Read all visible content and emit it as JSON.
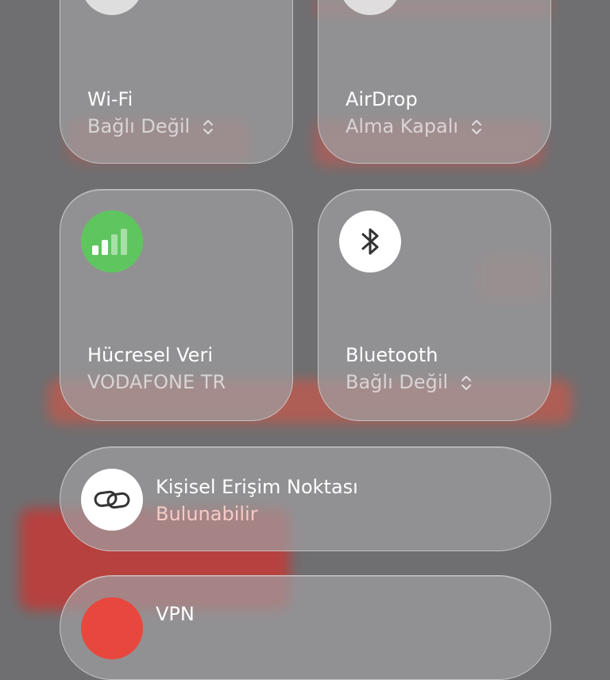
{
  "tiles": {
    "wifi": {
      "title": "Wi-Fi",
      "subtitle": "Bağlı Değil"
    },
    "airdrop": {
      "title": "AirDrop",
      "subtitle": "Alma Kapalı"
    },
    "cellular": {
      "title": "Hücresel Veri",
      "subtitle": "VODAFONE TR",
      "icon": "cellular-signal-icon",
      "icon_color": "#5fc65f"
    },
    "bluetooth": {
      "title": "Bluetooth",
      "subtitle": "Bağlı Değil",
      "icon": "bluetooth-icon"
    },
    "hotspot": {
      "title": "Kişisel Erişim Noktası",
      "subtitle": "Bulunabilir",
      "icon": "link-icon"
    },
    "vpn": {
      "title": "VPN",
      "icon": "vpn-icon",
      "icon_color": "#e8473d"
    }
  },
  "colors": {
    "accent_green": "#5fc65f",
    "accent_red": "#e8473d"
  }
}
